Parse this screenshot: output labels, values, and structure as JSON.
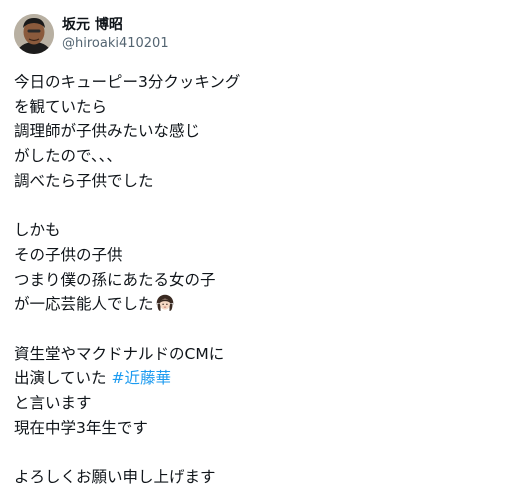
{
  "author": {
    "display_name": "坂元 博昭",
    "handle": "@hiroaki410201",
    "avatar_icon": "person-avatar-icon"
  },
  "tweet": {
    "lines": [
      "今日のキューピー3分クッキング",
      "を観ていたら",
      "調理師が子供みたいな感じ",
      "がしたので、、、",
      "調べたら子供でした",
      "",
      "しかも",
      "その子供の子供",
      "つまり僕の孫にあたる女の子",
      "が一応芸能人でした",
      "",
      "資生堂やマクドナルドのCMに",
      "出演していた ",
      "と言います",
      "現在中学3年生です",
      "",
      "よろしくお願い申し上げます"
    ],
    "hashtag": "#近藤華",
    "emoji_icon": "girl-emoji-icon",
    "hashtag_color": "#1d9bf0"
  }
}
